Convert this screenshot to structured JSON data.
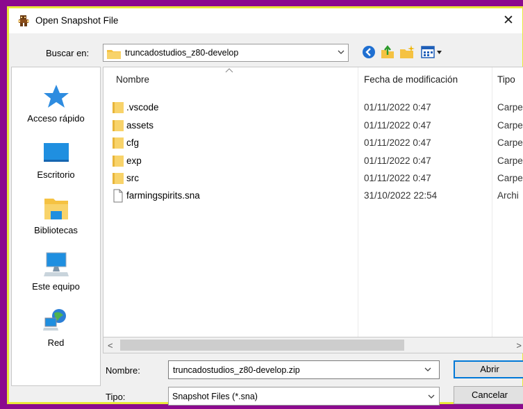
{
  "window": {
    "title": "Open Snapshot File",
    "close_glyph": "✕"
  },
  "look_in": {
    "label": "Buscar en:",
    "value": "truncadostudios_z80-develop"
  },
  "toolbar": {
    "icons": [
      "back-icon",
      "up-folder-icon",
      "new-folder-icon",
      "view-menu-icon"
    ]
  },
  "places": [
    {
      "label": "Acceso rápido",
      "icon": "star-icon"
    },
    {
      "label": "Escritorio",
      "icon": "desktop-icon"
    },
    {
      "label": "Bibliotecas",
      "icon": "libraries-icon"
    },
    {
      "label": "Este equipo",
      "icon": "computer-icon"
    },
    {
      "label": "Red",
      "icon": "network-icon"
    }
  ],
  "columns": {
    "name": "Nombre",
    "modified": "Fecha de modificación",
    "type": "Tipo"
  },
  "files": [
    {
      "name": ".vscode",
      "modified": "01/11/2022 0:47",
      "type": "Carpe",
      "kind": "folder"
    },
    {
      "name": "assets",
      "modified": "01/11/2022 0:47",
      "type": "Carpe",
      "kind": "folder"
    },
    {
      "name": "cfg",
      "modified": "01/11/2022 0:47",
      "type": "Carpe",
      "kind": "folder"
    },
    {
      "name": "exp",
      "modified": "01/11/2022 0:47",
      "type": "Carpe",
      "kind": "folder"
    },
    {
      "name": "src",
      "modified": "01/11/2022 0:47",
      "type": "Carpe",
      "kind": "folder"
    },
    {
      "name": "farmingspirits.sna",
      "modified": "31/10/2022 22:54",
      "type": "Archi",
      "kind": "file"
    }
  ],
  "scrollbar": {
    "left_glyph": "<",
    "right_glyph": ">"
  },
  "filename": {
    "label": "Nombre:",
    "value": "truncadostudios_z80-develop.zip"
  },
  "filetype": {
    "label": "Tipo:",
    "value": "Snapshot Files (*.sna)"
  },
  "buttons": {
    "open": "Abrir",
    "cancel": "Cancelar"
  },
  "colors": {
    "outer_background": "#8b0a8e",
    "dialog_border": "#e8e83a",
    "folder": "#f5c242",
    "default_button_border": "#0078d7"
  }
}
